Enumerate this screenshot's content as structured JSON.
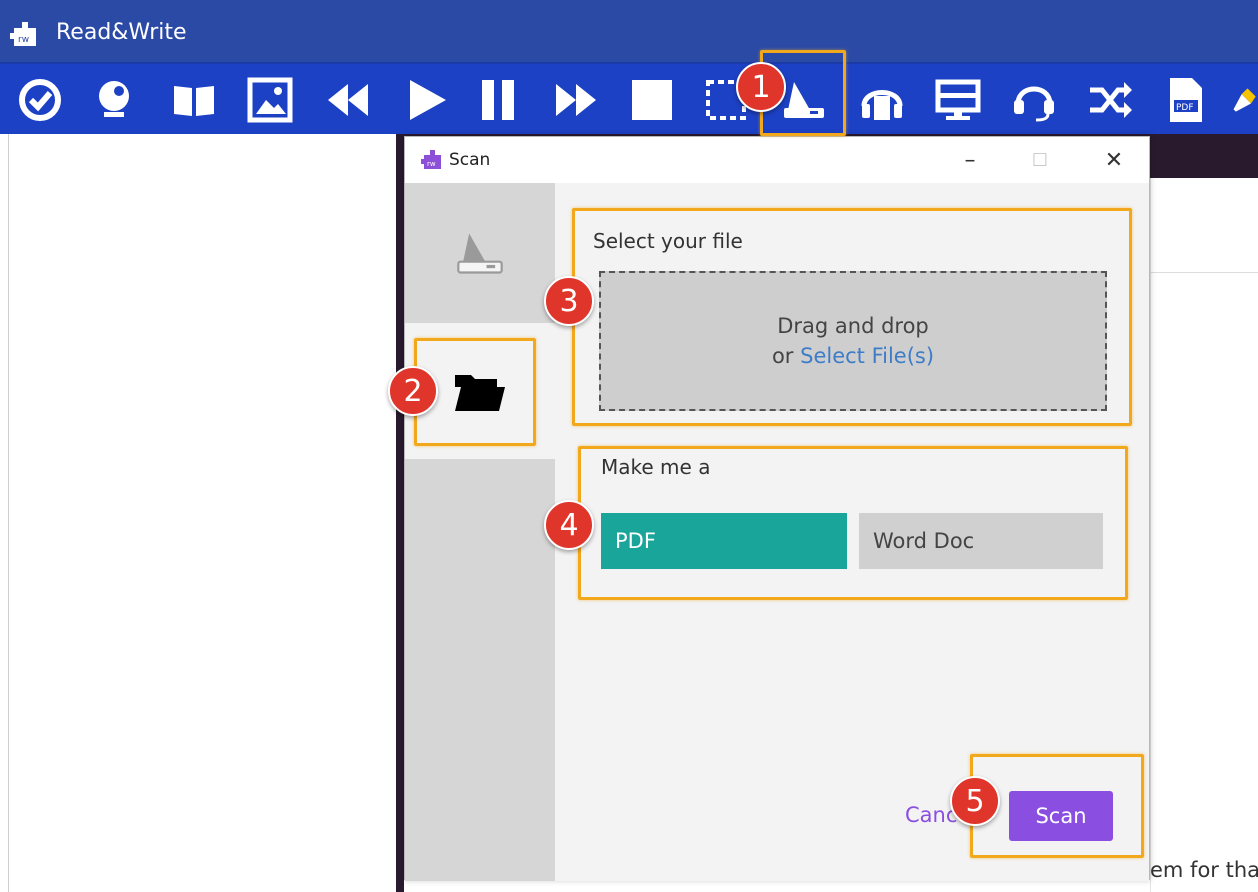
{
  "app": {
    "title": "Read&Write",
    "accent": "#1d41c4"
  },
  "toolbar": {
    "tools": [
      {
        "icon": "check-icon"
      },
      {
        "icon": "dictionary-icon"
      },
      {
        "icon": "picture-dictionary-book-icon"
      },
      {
        "icon": "picture-icon"
      },
      {
        "icon": "rewind-icon"
      },
      {
        "icon": "play-icon"
      },
      {
        "icon": "pause-icon"
      },
      {
        "icon": "fast-forward-icon"
      },
      {
        "icon": "stop-icon"
      },
      {
        "icon": "screenshot-reader-icon"
      },
      {
        "icon": "scan-icon"
      },
      {
        "icon": "audio-maker-icon"
      },
      {
        "icon": "screen-masking-icon"
      },
      {
        "icon": "headset-icon"
      },
      {
        "icon": "shuffle-icon"
      },
      {
        "icon": "pdf-icon"
      },
      {
        "icon": "highlighter-icon"
      }
    ]
  },
  "dialog": {
    "title": "Scan",
    "minimize": "–",
    "maximize": "☐",
    "close": "✕",
    "select_label": "Select your file",
    "drop_line1": "Drag and drop",
    "drop_or": "or",
    "drop_link": "Select File(s)",
    "make_label": "Make me a",
    "formats": [
      "PDF",
      "Word Doc"
    ],
    "selected_format": "PDF",
    "cancel_label": "Canc",
    "scan_label": "Scan"
  },
  "annotations": [
    "1",
    "2",
    "3",
    "4",
    "5"
  ],
  "background": {
    "partial_text": "em for that"
  },
  "colors": {
    "highlight": "#f2a81d",
    "badge": "#e0352b",
    "pdf_button": "#1aa59a",
    "scan_button": "#8a4fe0",
    "link": "#3d7dc8"
  }
}
